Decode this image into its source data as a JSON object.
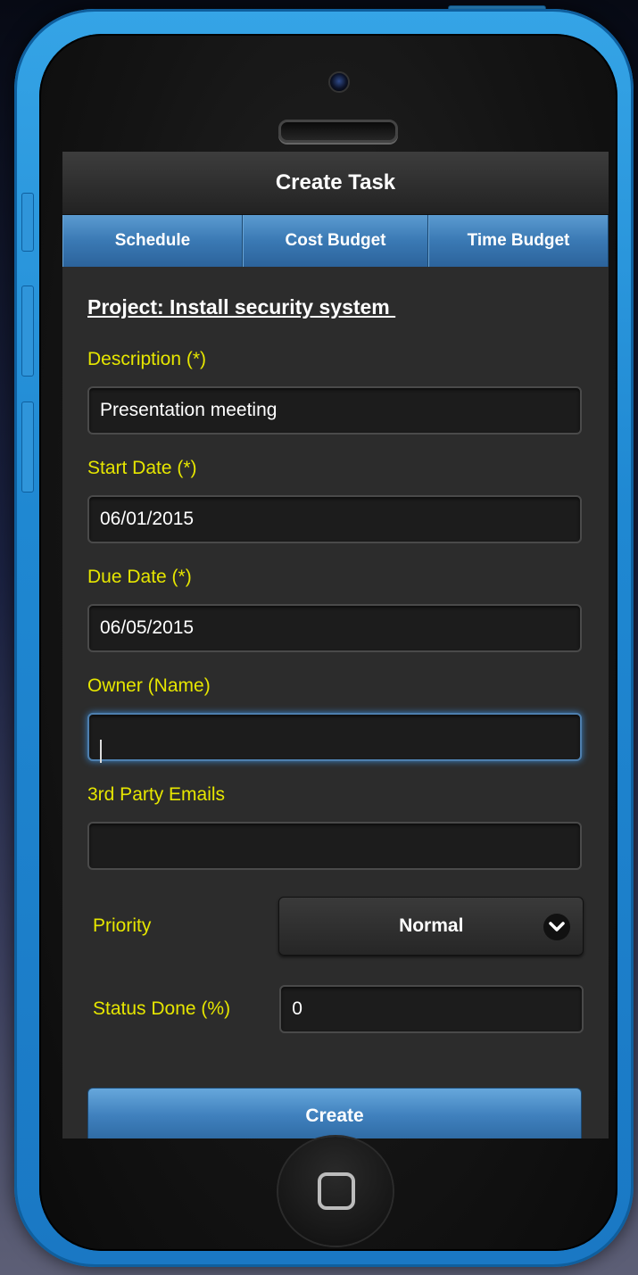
{
  "header": {
    "title": "Create Task"
  },
  "tabs": [
    {
      "label": "Schedule"
    },
    {
      "label": "Cost Budget"
    },
    {
      "label": "Time Budget"
    }
  ],
  "project": {
    "title": "Project: Install security system "
  },
  "form": {
    "description": {
      "label": "Description (*)",
      "value": "Presentation meeting"
    },
    "start_date": {
      "label": "Start Date (*)",
      "value": "06/01/2015"
    },
    "due_date": {
      "label": "Due Date (*)",
      "value": "06/05/2015"
    },
    "owner": {
      "label": "Owner (Name)",
      "value": ""
    },
    "third_party_emails": {
      "label": "3rd Party Emails",
      "value": ""
    },
    "priority": {
      "label": "Priority",
      "value": "Normal"
    },
    "status_done": {
      "label": "Status Done (%)",
      "value": "0"
    }
  },
  "actions": {
    "create_label": "Create"
  },
  "colors": {
    "phone_frame": "#2196d9",
    "field_label": "#e6e600",
    "tab_accent": "#3a79b4",
    "screen_bg": "#2c2c2c"
  },
  "icons": {
    "select_arrow": "chevron-down-icon",
    "home": "home-button-icon"
  }
}
